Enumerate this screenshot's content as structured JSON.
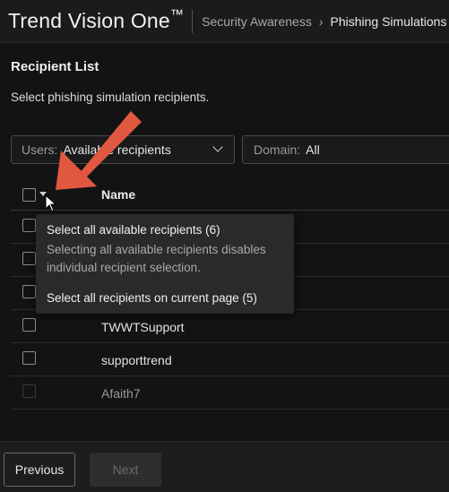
{
  "header": {
    "brand": "Trend Vision One",
    "brand_mark": "™",
    "breadcrumb": [
      "Security Awareness",
      "Phishing Simulations"
    ],
    "separator": "›"
  },
  "page": {
    "title": "Recipient List",
    "description": "Select phishing simulation recipients."
  },
  "filters": {
    "users_label": "Users:",
    "users_value": "Available recipients",
    "domain_label": "Domain:",
    "domain_value": "All"
  },
  "table": {
    "column_name": "Name",
    "rows": [
      {
        "name": "",
        "disabled": false
      },
      {
        "name": "",
        "disabled": false
      },
      {
        "name": "",
        "disabled": false
      },
      {
        "name": "TWWTSupport",
        "disabled": false
      },
      {
        "name": "supporttrend",
        "disabled": false
      },
      {
        "name": "Afaith7",
        "disabled": true
      }
    ]
  },
  "select_menu": {
    "select_all_available": "Select all available recipients (6)",
    "select_all_desc": "Selecting all available recipients disables individual recipient selection.",
    "select_current_page": "Select all recipients on current page (5)"
  },
  "footer": {
    "previous": "Previous",
    "next": "Next"
  },
  "colors": {
    "annotation_arrow": "#e0583f",
    "background": "#131313"
  }
}
